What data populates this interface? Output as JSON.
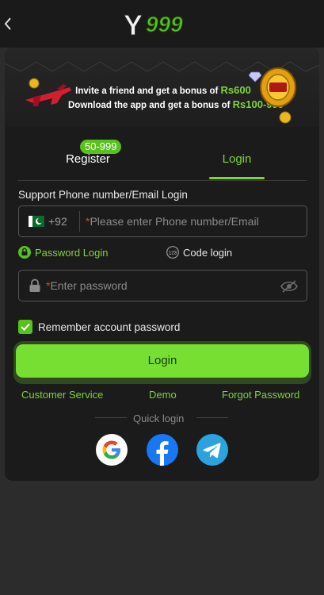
{
  "header": {
    "logo_text": "Y999"
  },
  "banner": {
    "line1_prefix": "Invite a friend and get a bonus of ",
    "line1_amount": "Rs600",
    "line2_prefix": "Download the app and get a bonus of ",
    "line2_amount": "Rs100-999"
  },
  "tabs": {
    "register_label": "Register",
    "register_badge": "50-999",
    "login_label": "Login",
    "active": "login"
  },
  "form": {
    "section_label": "Support Phone number/Email Login",
    "country_code": "+92",
    "phone_placeholder_req": "*",
    "phone_placeholder": "Please enter Phone number/Email",
    "mode_password_label": "Password Login",
    "mode_code_label": "Code login",
    "password_placeholder_req": "*",
    "password_placeholder": "Enter password",
    "remember_label": "Remember account password",
    "remember_checked": true,
    "login_button": "Login"
  },
  "links": {
    "customer_service": "Customer Service",
    "demo": "Demo",
    "forgot_password": "Forgot Password"
  },
  "quick_login": {
    "label": "Quick login",
    "providers": [
      "google",
      "facebook",
      "telegram"
    ]
  },
  "colors": {
    "accent": "#7ed33b",
    "button": "#76df32",
    "background": "#1b1b1b",
    "facebook": "#1877f2",
    "telegram": "#2aa3de"
  }
}
